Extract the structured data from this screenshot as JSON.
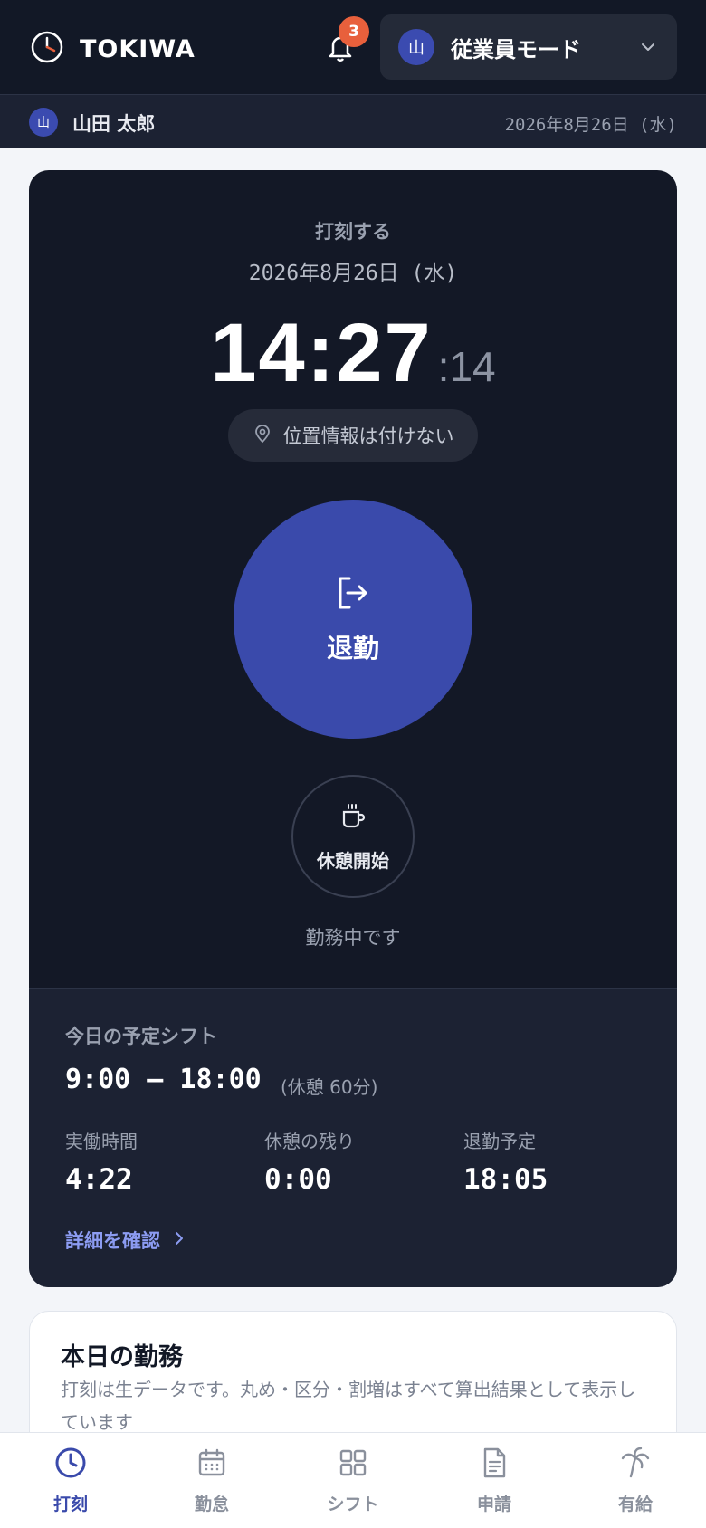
{
  "header": {
    "app_name": "TOKIWA",
    "notification_count": "3",
    "mode_avatar": "山",
    "mode_label": "従業員モード"
  },
  "user": {
    "avatar": "山",
    "name": "山田 太郎",
    "date": "2026年8月26日 (水)"
  },
  "punch": {
    "title": "打刻する",
    "date": "2026年8月26日 (水)",
    "time_main": "14:27",
    "time_seconds": ":14",
    "location_label": "位置情報は付けない",
    "clock_out_label": "退勤",
    "break_start_label": "休憩開始",
    "status": "勤務中です"
  },
  "shift": {
    "title": "今日の予定シフト",
    "time_range": "9:00 – 18:00",
    "break_info": "(休憩 60分)",
    "stats": [
      {
        "label": "実働時間",
        "value": "4:22"
      },
      {
        "label": "休憩の残り",
        "value": "0:00"
      },
      {
        "label": "退勤予定",
        "value": "18:05"
      }
    ],
    "detail_link": "詳細を確認"
  },
  "today": {
    "title": "本日の勤務",
    "description": "打刻は生データです。丸め・区分・割増はすべて算出結果として表示しています"
  },
  "nav": [
    {
      "label": "打刻",
      "icon": "clock-icon",
      "active": true
    },
    {
      "label": "勤怠",
      "icon": "calendar-icon",
      "active": false
    },
    {
      "label": "シフト",
      "icon": "grid-icon",
      "active": false
    },
    {
      "label": "申請",
      "icon": "document-icon",
      "active": false
    },
    {
      "label": "有給",
      "icon": "palm-tree-icon",
      "active": false
    }
  ],
  "colors": {
    "primary": "#3a4aab",
    "header_bg": "#121826",
    "badge": "#e8603c",
    "link": "#8c9cf2"
  }
}
